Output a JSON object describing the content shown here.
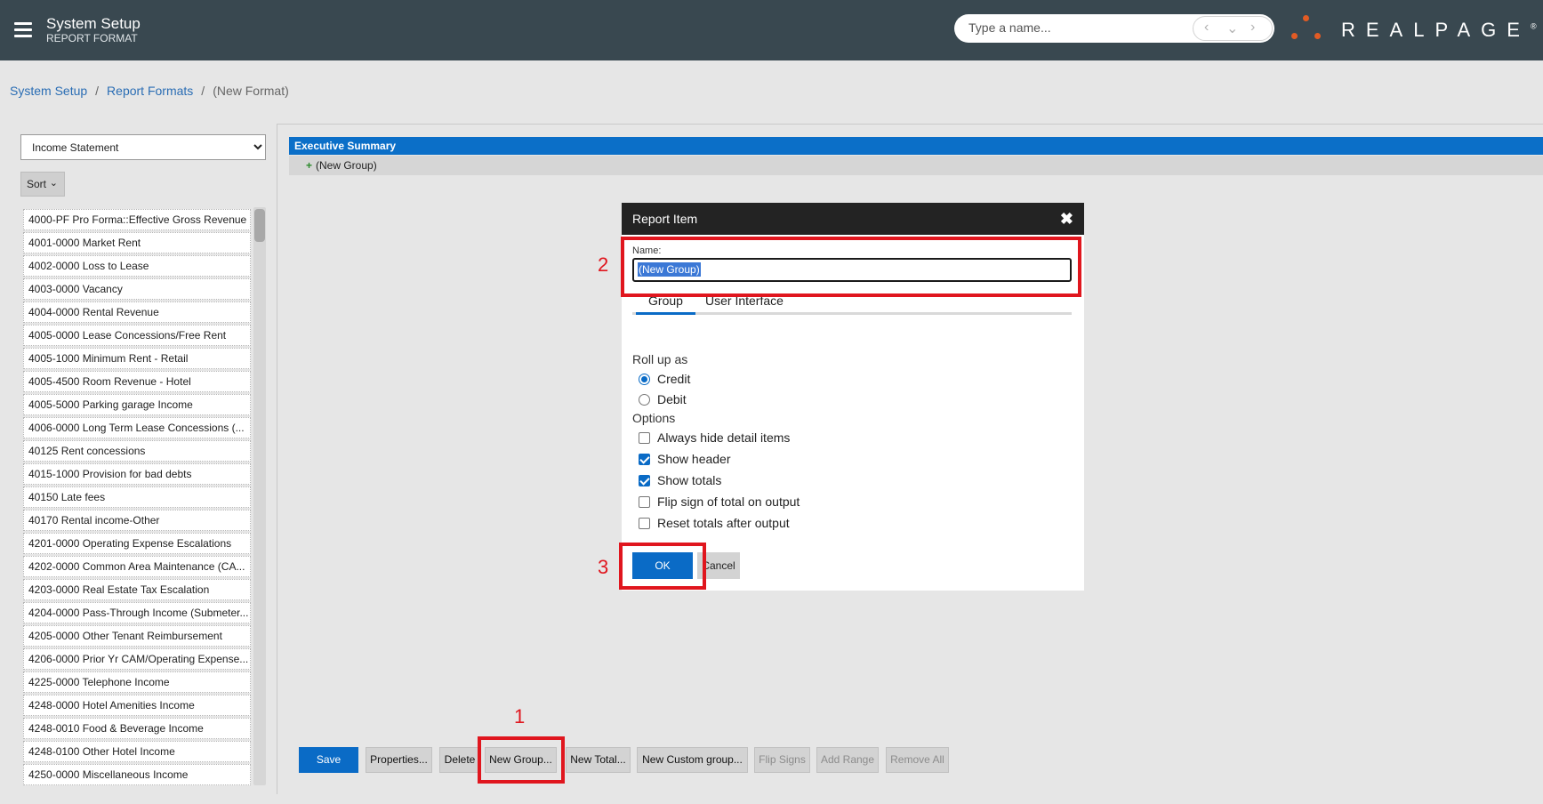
{
  "header": {
    "title": "System Setup",
    "subtitle": "REPORT FORMAT",
    "search_placeholder": "Type a name...",
    "logo_text": "REALPAGE",
    "logo_mark": "®",
    "nav_prev": "‹",
    "nav_down": "⌄",
    "nav_next": "›"
  },
  "breadcrumb": {
    "items": [
      "System Setup",
      "Report Formats"
    ],
    "current": "(New Format)",
    "separator": "/"
  },
  "left_panel": {
    "statement_type": "Income Statement",
    "sort_label": "Sort",
    "accounts": [
      "4000-PF Pro Forma::Effective Gross Revenue",
      "4001-0000 Market Rent",
      "4002-0000 Loss to Lease",
      "4003-0000 Vacancy",
      "4004-0000 Rental Revenue",
      "4005-0000 Lease Concessions/Free Rent",
      "4005-1000 Minimum Rent - Retail",
      "4005-4500 Room Revenue - Hotel",
      "4005-5000 Parking garage Income",
      "4006-0000 Long Term Lease Concessions (...",
      "40125 Rent concessions",
      "4015-1000 Provision for bad debts",
      "40150 Late fees",
      "40170 Rental income-Other",
      "4201-0000 Operating Expense Escalations",
      "4202-0000 Common Area Maintenance (CA...",
      "4203-0000 Real Estate Tax Escalation",
      "4204-0000 Pass-Through Income (Submeter...",
      "4205-0000 Other Tenant Reimbursement",
      "4206-0000 Prior Yr CAM/Operating Expense...",
      "4225-0000 Telephone Income",
      "4248-0000 Hotel Amenities Income",
      "4248-0010 Food & Beverage Income",
      "4248-0100 Other Hotel Income",
      "4250-0000 Miscellaneous Income"
    ]
  },
  "format_tree": {
    "section": "Executive Summary",
    "group_plus": "+",
    "group": "(New Group)"
  },
  "toolbar": {
    "save": "Save",
    "properties": "Properties...",
    "delete": "Delete",
    "new_group": "New Group...",
    "new_total": "New Total...",
    "new_custom_group": "New Custom group...",
    "flip_signs": "Flip Signs",
    "add_range": "Add Range",
    "remove_all": "Remove All"
  },
  "dialog": {
    "title": "Report Item",
    "close": "✖",
    "name_label": "Name:",
    "name_value": "(New Group)",
    "tabs": [
      "Group",
      "User Interface"
    ],
    "rollup_label": "Roll up as",
    "rollup_options": [
      "Credit",
      "Debit"
    ],
    "rollup_selected": "Credit",
    "options_label": "Options",
    "options": [
      {
        "label": "Always hide detail items",
        "checked": false
      },
      {
        "label": "Show header",
        "checked": true
      },
      {
        "label": "Show totals",
        "checked": true
      },
      {
        "label": "Flip sign of total on output",
        "checked": false
      },
      {
        "label": "Reset totals after output",
        "checked": false
      }
    ],
    "ok": "OK",
    "cancel": "Cancel"
  },
  "annotations": {
    "step1": "1",
    "step2": "2",
    "step3": "3",
    "color": "#e0161e"
  },
  "colors": {
    "header_bg": "#394850",
    "accent": "#0a6bc6",
    "logo_orange": "#e25b24"
  }
}
